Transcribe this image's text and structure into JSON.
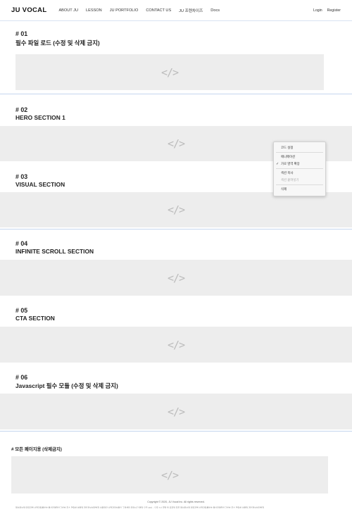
{
  "header": {
    "logo": "JU VOCAL",
    "nav": [
      "ABOUT JU",
      "LESSON",
      "JU PORTFOLIO",
      "CONTACT US",
      "JU 프렌차이즈",
      "Docs"
    ],
    "auth": {
      "login": "Login",
      "register": "Register"
    }
  },
  "sections": [
    {
      "num": "# 01",
      "title": "필수 파일 로드 (수정 및 삭제 금지)"
    },
    {
      "num": "# 02",
      "title": "HERO SECTION 1"
    },
    {
      "num": "# 03",
      "title": "VISUAL SECTION"
    },
    {
      "num": "# 04",
      "title": "INFINITE SCROLL SECTION"
    },
    {
      "num": "# 05",
      "title": "CTA SECTION"
    },
    {
      "num": "# 06",
      "title": "Javascript 필수 모듈 (수정 및 삭제 금지)"
    }
  ],
  "placeholder_icon": "code-icon",
  "placeholder_glyph": "</>",
  "context_menu": {
    "code_settings": "코드 설정",
    "animation": "애니메이션",
    "horizontal_expand": "가로 영역 확장",
    "check_mark": "✓",
    "copy_section": "섹션 복사",
    "paste_section": "섹션 붙여넣기",
    "delete": "삭제"
  },
  "footer": {
    "all_pages_title": "# 모든 페이지용 (삭제금지)",
    "copyright": "Copyright © 2020, JU Vocal Inc. All rights reserved.",
    "business_line": "제이유보컬 대표자명 사업자등록번호 통신판매업신고번호 주소 연락처 이메일 개인정보처리방침 이용약관 사업자정보확인 고객센터 운영시간 평일 오전 10시 - 오후 7시 주말 및 공휴일 휴무 제이유보컬 대표자명 사업자등록번호 통신판매업신고번호 주소 연락처 이메일 개인정보처리방침"
  },
  "colors": {
    "accent_divider": "#c5d6ee",
    "placeholder_bg": "#ededed"
  }
}
